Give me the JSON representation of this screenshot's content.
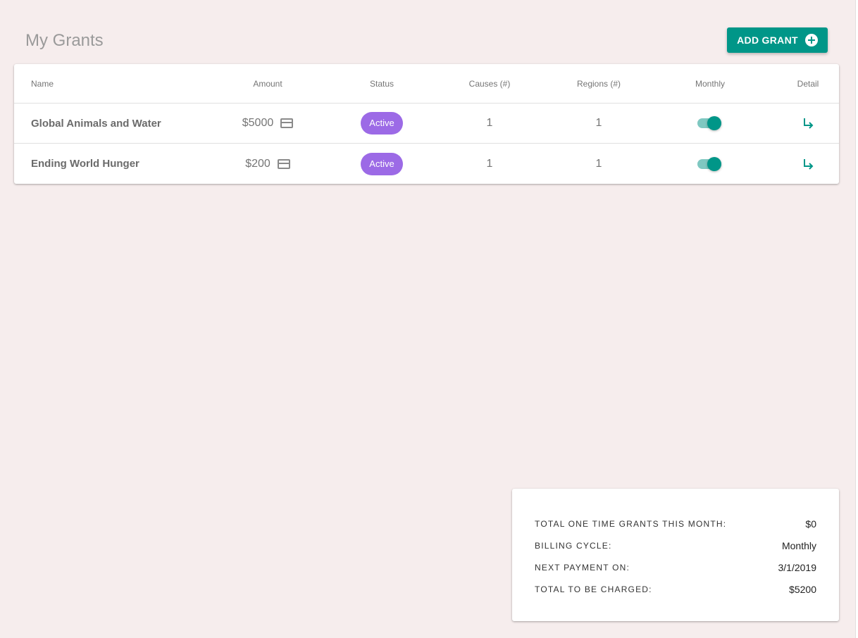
{
  "header": {
    "title": "My Grants",
    "add_button_label": "ADD GRANT"
  },
  "table": {
    "columns": {
      "name": "Name",
      "amount": "Amount",
      "status": "Status",
      "causes": "Causes (#)",
      "regions": "Regions (#)",
      "monthly": "Monthly",
      "detail": "Detail"
    },
    "rows": [
      {
        "name": "Global Animals and Water",
        "amount": "$5000",
        "status": "Active",
        "causes": "1",
        "regions": "1",
        "monthly": true
      },
      {
        "name": "Ending World Hunger",
        "amount": "$200",
        "status": "Active",
        "causes": "1",
        "regions": "1",
        "monthly": true
      }
    ]
  },
  "summary": {
    "items": [
      {
        "label": "TOTAL ONE TIME GRANTS THIS MONTH:",
        "value": "$0"
      },
      {
        "label": "BILLING CYCLE:",
        "value": "Monthly"
      },
      {
        "label": "NEXT PAYMENT ON:",
        "value": "3/1/2019"
      },
      {
        "label": "TOTAL TO BE CHARGED:",
        "value": "$5200"
      }
    ]
  },
  "icons": {
    "add": "plus-circle-icon",
    "payment": "credit-card-icon",
    "detail": "subdirectory-arrow-right-icon"
  },
  "colors": {
    "background": "#f6eded",
    "primary": "#009688",
    "status_active": "#9c6ae6",
    "toggle_track": "#7fc8c1"
  }
}
